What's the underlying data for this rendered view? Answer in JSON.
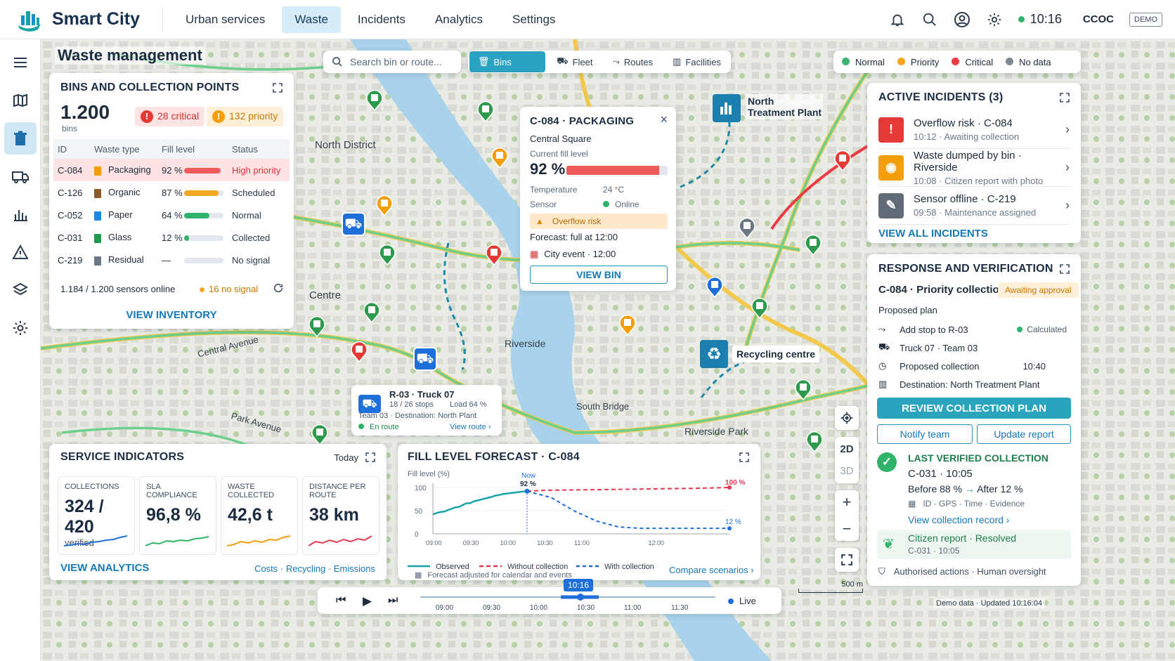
{
  "app": {
    "name": "Smart City",
    "org": "CCOC",
    "demo": "DEMO",
    "time": "10:16"
  },
  "nav": [
    "Urban services",
    "Waste",
    "Incidents",
    "Analytics",
    "Settings"
  ],
  "page_title": "Waste management",
  "search": {
    "placeholder": "Search bin or route..."
  },
  "filters": [
    "Bins",
    "Fleet",
    "Routes",
    "Facilities"
  ],
  "legend": [
    {
      "label": "Normal",
      "color": "#3cb371"
    },
    {
      "label": "Priority",
      "color": "#f5a623"
    },
    {
      "label": "Critical",
      "color": "#ee3b43"
    },
    {
      "label": "No data",
      "color": "#7d8a96"
    }
  ],
  "inventory": {
    "title": "BINS AND COLLECTION POINTS",
    "count": "1.200",
    "count_unit": "bins",
    "critical": "28 critical",
    "priority": "132 priority",
    "headers": [
      "ID",
      "Waste type",
      "Fill level",
      "Status"
    ],
    "rows": [
      {
        "id": "C-084",
        "type": "Packaging",
        "fill": "92 %",
        "level": 0.92,
        "status": "High priority",
        "bin_color": "#f59e0b",
        "bar_color": "#ef5b5b",
        "status_color": "#d6333b"
      },
      {
        "id": "C-126",
        "type": "Organic",
        "fill": "87 %",
        "level": 0.87,
        "status": "Scheduled",
        "bin_color": "#8b5a2b",
        "bar_color": "#f5a623",
        "status_color": "#2c3c4e"
      },
      {
        "id": "C-052",
        "type": "Paper",
        "fill": "64 %",
        "level": 0.64,
        "status": "Normal",
        "bin_color": "#1e88e5",
        "bar_color": "#2fb36b",
        "status_color": "#2c3c4e"
      },
      {
        "id": "C-031",
        "type": "Glass",
        "fill": "12 %",
        "level": 0.12,
        "status": "Collected",
        "bin_color": "#1f9a4c",
        "bar_color": "#2fb36b",
        "status_color": "#2c3c4e"
      },
      {
        "id": "C-219",
        "type": "Residual",
        "fill": "—",
        "level": 0,
        "status": "No signal",
        "bin_color": "#6b7785",
        "bar_color": "#cfd6de",
        "status_color": "#2c3c4e"
      }
    ],
    "sensors": "1.184 / 1.200 sensors online",
    "no_signal": "16 no signal",
    "view": "VIEW INVENTORY"
  },
  "map_labels": [
    "North District",
    "Centre",
    "Riverside",
    "Central Avenue",
    "Park Avenue",
    "South Bridge",
    "Riverside Park"
  ],
  "facilities": {
    "north": "North\nTreatment Plant",
    "recycling": "Recycling centre"
  },
  "popup": {
    "title": "C-084 · PACKAGING",
    "location": "Central Square",
    "fill_label": "Current fill level",
    "fill_value": "92 %",
    "fill_level": 0.92,
    "temp_label": "Temperature",
    "temp_value": "24 °C",
    "sensor_label": "Sensor",
    "sensor_value": "Online",
    "risk": "Overflow risk",
    "forecast": "Forecast: full at 12:00",
    "event": "City event · 12:00",
    "view": "VIEW BIN"
  },
  "truck_card": {
    "title": "R-03 · Truck 07",
    "stops": "18 / 26 stops",
    "load": "Load 64 %",
    "team": "Team 03 · Destination: North Plant",
    "status": "En route",
    "view": "View route"
  },
  "incidents": {
    "title": "ACTIVE INCIDENTS (3)",
    "items": [
      {
        "title": "Overflow risk · C-084",
        "time": "10:12",
        "sub": "Awaiting collection",
        "color": "#e53935",
        "icon": "warning-icon"
      },
      {
        "title": "Waste dumped by bin · Riverside",
        "time": "10:08",
        "sub": "Citizen report with photo",
        "color": "#f59e0b",
        "icon": "camera-icon"
      },
      {
        "title": "Sensor offline · C-219",
        "time": "09:58",
        "sub": "Maintenance assigned",
        "color": "#616c78",
        "icon": "wrench-icon"
      }
    ],
    "view_all": "VIEW ALL INCIDENTS"
  },
  "response": {
    "title": "RESPONSE AND VERIFICATION",
    "plan_title": "C-084 · Priority collection",
    "plan_status": "Awaiting approval",
    "proposed": "Proposed plan",
    "stop": "Add stop to R-03",
    "calculated": "Calculated",
    "truck": "Truck 07 · Team 03",
    "collection_label": "Proposed collection",
    "collection_time": "10:40",
    "destination": "Destination: North Treatment Plant",
    "review": "REVIEW COLLECTION PLAN",
    "notify": "Notify team",
    "update": "Update report",
    "last_title": "LAST VERIFIED COLLECTION",
    "last_id": "C-031 · 10:05",
    "before": "Before 88 %",
    "after": "After 12 %",
    "evidence": "ID · GPS · Time · Evidence",
    "record": "View collection record",
    "citizen": "Citizen report · Resolved",
    "citizen_sub": "C-031 · 10:05",
    "authorised": "Authorised actions · Human oversight"
  },
  "indicators": {
    "title": "SERVICE INDICATORS",
    "period": "Today",
    "kpis": [
      {
        "label": "COLLECTIONS",
        "value": "324 / 420",
        "sub": "verified",
        "color": "#1e6fd9"
      },
      {
        "label": "SLA COMPLIANCE",
        "value": "96,8 %",
        "sub": "",
        "color": "#2fb36b"
      },
      {
        "label": "WASTE COLLECTED",
        "value": "42,6 t",
        "sub": "",
        "color": "#f59e0b"
      },
      {
        "label": "DISTANCE PER ROUTE",
        "value": "38 km",
        "sub": "",
        "color": "#e53950"
      }
    ],
    "view": "VIEW ANALYTICS",
    "links": "Costs · Recycling · Emissions"
  },
  "chart_data": {
    "type": "line",
    "title": "FILL LEVEL FORECAST · C-084",
    "ylabel": "Fill level (%)",
    "ylim": [
      0,
      100
    ],
    "yticks": [
      "100",
      "50",
      "0"
    ],
    "x_ticks": [
      "09:00",
      "09:30",
      "10:00",
      "10:30",
      "11:00",
      "12:00"
    ],
    "now_label": "Now",
    "now_value": "92 %",
    "end_without": "100 %",
    "end_with": "12 %",
    "series": [
      {
        "name": "Observed",
        "color": "#17a2a8",
        "x": [
          0,
          0.05,
          0.1,
          0.15,
          0.2,
          0.25,
          0.3,
          0.35,
          0.4,
          0.45,
          0.5,
          0.55,
          0.6,
          0.65,
          0.7,
          0.75,
          0.8,
          0.85,
          0.9,
          0.95,
          1.0,
          1.05,
          1.1,
          1.15,
          1.2,
          1.27
        ],
        "y": [
          42,
          45,
          47,
          48,
          51,
          54,
          57,
          58,
          62,
          66,
          66,
          70,
          72,
          74,
          76,
          78,
          80,
          83,
          84,
          86,
          87,
          88,
          89,
          90,
          91,
          92
        ]
      },
      {
        "name": "Without collection",
        "color": "#e53950",
        "x": [
          1.27,
          1.5,
          2.0,
          2.5,
          3.0,
          3.5,
          4.0
        ],
        "y": [
          92,
          94,
          95,
          96,
          97,
          98,
          100
        ]
      },
      {
        "name": "With collection",
        "color": "#1e6fd9",
        "x": [
          1.27,
          1.6,
          1.9,
          2.2,
          2.5,
          2.8,
          3.2,
          3.6,
          4.0
        ],
        "y": [
          92,
          78,
          50,
          28,
          15,
          12,
          12,
          12,
          12
        ]
      }
    ],
    "note": "Forecast adjusted for calendar and events",
    "compare": "Compare scenarios"
  },
  "timeline": {
    "current": "10:16",
    "ticks": [
      "09:00",
      "09:30",
      "10:00",
      "10:30",
      "11:00",
      "11:30"
    ],
    "live": "Live"
  },
  "map_controls": {
    "d2": "2D",
    "d3": "3D",
    "plus": "+",
    "minus": "−"
  },
  "scale": "500 m",
  "footer": "Demo data · Updated 10:16:04"
}
